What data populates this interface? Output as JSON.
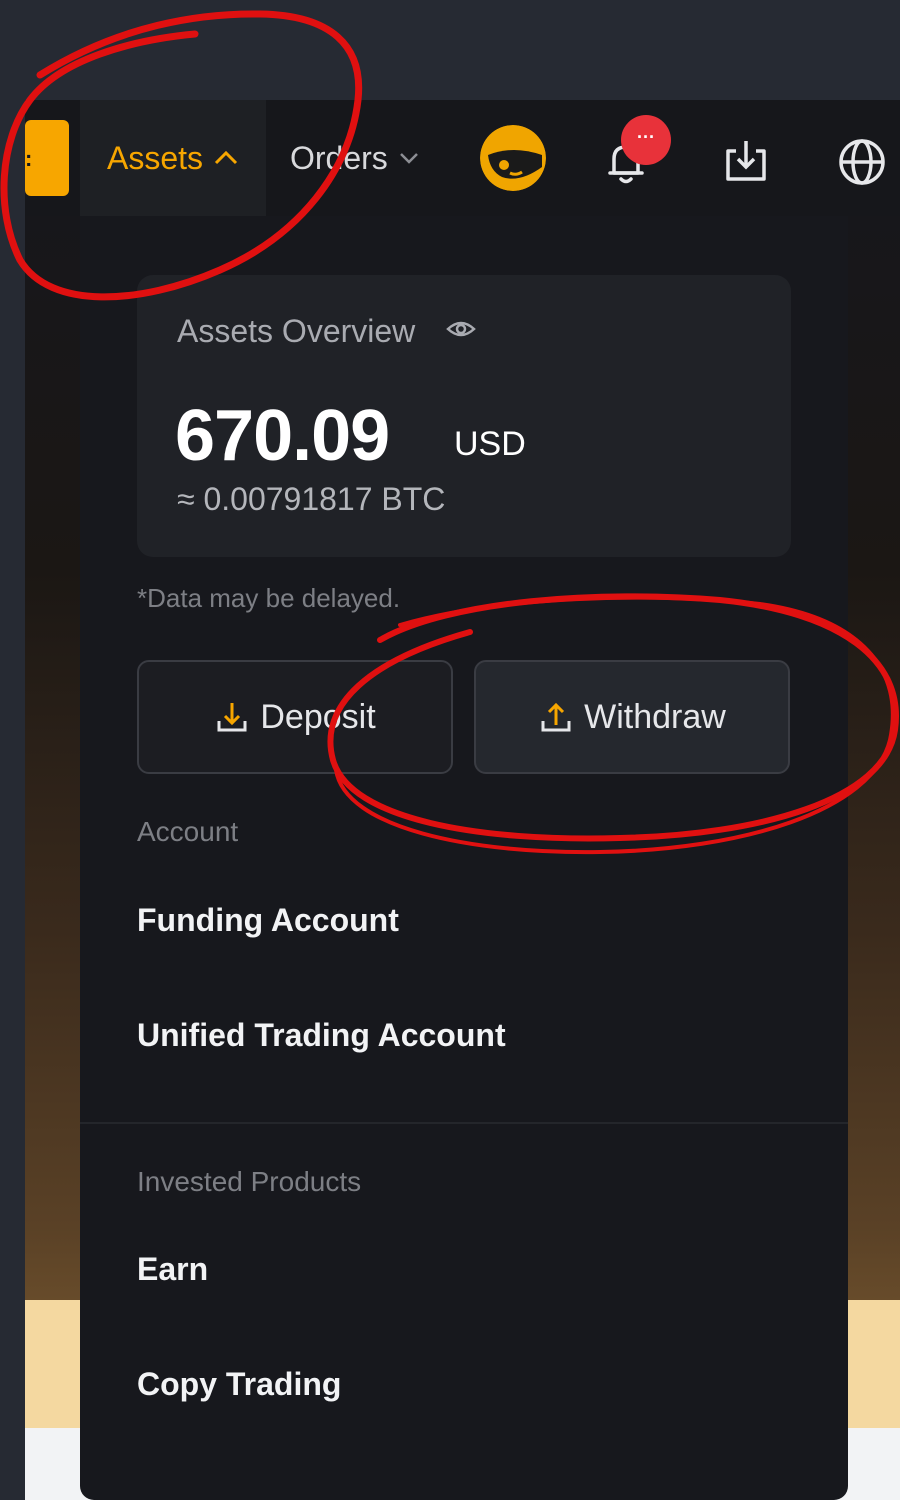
{
  "nav": {
    "assets_label": "Assets",
    "orders_label": "Orders",
    "notification_badge": "···"
  },
  "overview": {
    "title": "Assets Overview",
    "amount": "670.09",
    "currency": "USD",
    "btc_equivalent": "≈ 0.00791817 BTC",
    "delay_note": "*Data may be delayed."
  },
  "actions": {
    "deposit_label": "Deposit",
    "withdraw_label": "Withdraw"
  },
  "menu": {
    "account_section": "Account",
    "account_items": [
      "Funding Account",
      "Unified Trading Account"
    ],
    "invested_section": "Invested Products",
    "invested_items": [
      "Earn",
      "Copy Trading"
    ]
  },
  "colors": {
    "accent": "#f7a600",
    "badge": "#e8323a",
    "annotation": "#e01010",
    "panel": "#17181d"
  },
  "icons": [
    "chevron-up-icon",
    "chevron-down-icon",
    "avatar",
    "bell-icon",
    "download-icon",
    "globe-icon",
    "eye-icon",
    "deposit-icon",
    "withdraw-icon"
  ]
}
